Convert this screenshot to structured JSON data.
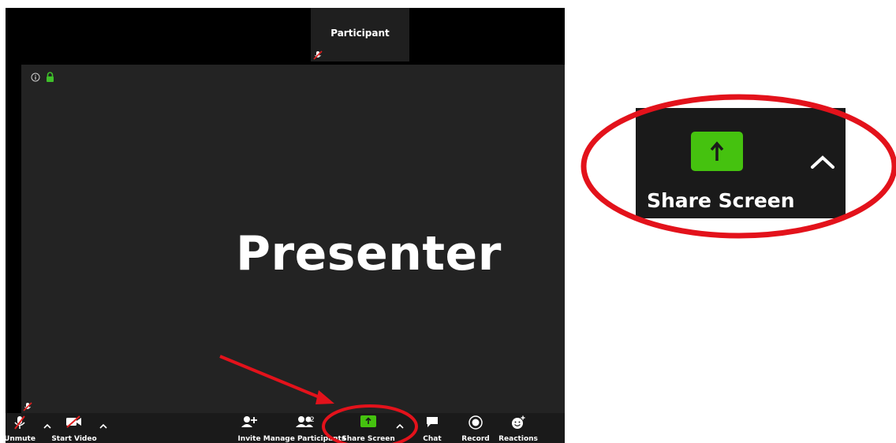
{
  "window": {
    "participant_tile": {
      "name": "Participant"
    },
    "stage": {
      "presenter_text": "Presenter"
    }
  },
  "toolbar": {
    "unmute": "Unmute",
    "start_video": "Start Video",
    "invite": "Invite",
    "manage_participants": "Manage Participants",
    "participant_count": "2",
    "share_screen": "Share Screen",
    "chat": "Chat",
    "record": "Record",
    "reactions": "Reactions"
  },
  "inset": {
    "share_screen": "Share Screen"
  },
  "colors": {
    "share_green": "#45c20f",
    "annotation_red": "#e3121b",
    "muted_red": "#e02020",
    "lock_green": "#3fbf2a"
  },
  "icons": {
    "unmute": "microphone-muted-icon",
    "start_video": "video-off-icon",
    "invite": "add-person-icon",
    "manage_participants": "participants-icon",
    "share_screen": "share-screen-icon",
    "chat": "chat-bubble-icon",
    "record": "record-icon",
    "reactions": "smiley-plus-icon"
  }
}
